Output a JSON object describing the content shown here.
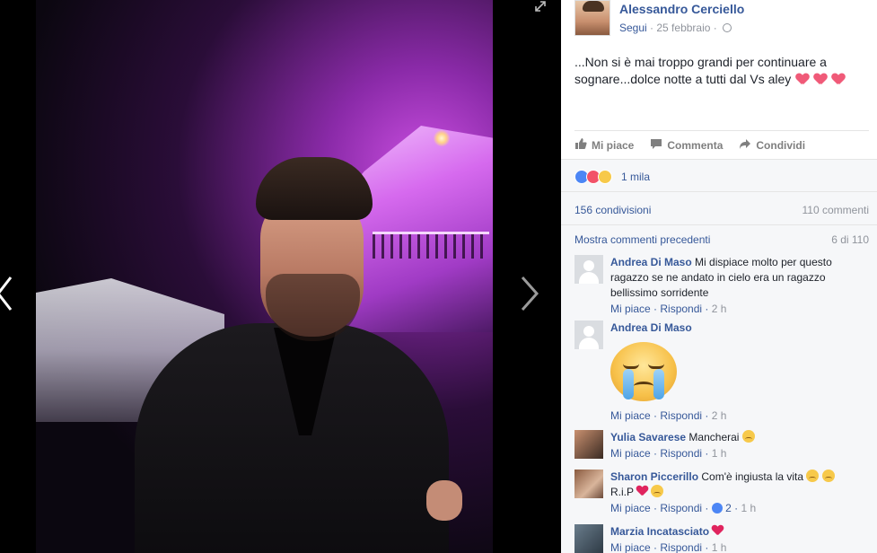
{
  "post": {
    "author": "Alessandro Cerciello",
    "follow": "Segui",
    "date": "· 25 febbraio ·",
    "text": "...Non si è mai troppo grandi per continuare a sognare...dolce notte a tutti dal Vs aley"
  },
  "actions": {
    "like": "Mi piace",
    "comment": "Commenta",
    "share": "Condividi"
  },
  "stats": {
    "reactions": "1 mila",
    "shares": "156 condivisioni",
    "comments": "110 commenti"
  },
  "comments_section": {
    "previous": "Mostra commenti precedenti",
    "page": "6 di 110",
    "like_label": "Mi piace",
    "reply_label": "Rispondi",
    "items": [
      {
        "name": "Andrea Di Maso",
        "text": "Mi dispiace molto per questo ragazzo se ne andato in cielo era un ragazzo bellissimo sorridente",
        "time": "2 h"
      },
      {
        "name": "Andrea Di Maso",
        "text": "",
        "time": "2 h"
      },
      {
        "name": "Yulia Savarese",
        "text": "Mancherai",
        "time": "1 h"
      },
      {
        "name": "Sharon Piccerillo",
        "text": "Com'è ingiusta la vita",
        "text2": "R.i.P",
        "likes": "2",
        "time": "1 h"
      },
      {
        "name": "Marzia Incatasciato",
        "text": "",
        "time": "1 h"
      }
    ]
  },
  "icons": {
    "prev": "chevron-left-icon",
    "next": "chevron-right-icon",
    "expand": "expand-icon",
    "privacy": "globe-icon"
  }
}
